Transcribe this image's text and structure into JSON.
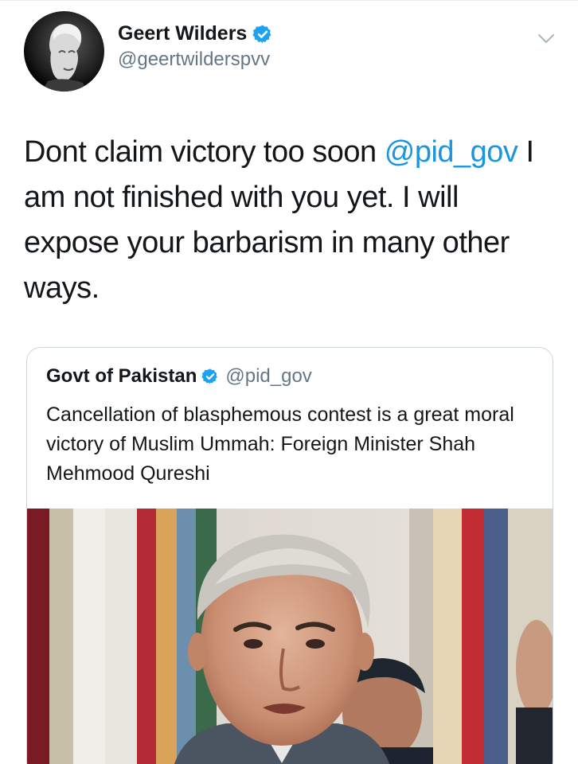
{
  "tweet": {
    "author": {
      "display_name": "Geert Wilders",
      "handle": "@geertwilderspvv",
      "verified": true,
      "avatar_icon": "profile-photo"
    },
    "text_parts": {
      "before_mention": "Dont claim victory too soon ",
      "mention": "@pid_gov",
      "after_mention": " I am not finished with you yet. I will expose your barbarism in many other ways."
    },
    "menu_icon": "chevron-down-icon"
  },
  "quoted_tweet": {
    "author": {
      "display_name": "Govt of Pakistan",
      "handle": "@pid_gov",
      "verified": true
    },
    "text": "Cancellation of blasphemous contest is a great moral victory of Muslim Ummah: Foreign Minister Shah Mehmood Qureshi",
    "media": {
      "type": "photo",
      "subject": "man speaking in front of flags"
    }
  },
  "colors": {
    "verified_blue": "#1da1f2",
    "link_blue": "#1b95e0",
    "secondary_text": "#657786",
    "border": "#ccd6dd"
  }
}
